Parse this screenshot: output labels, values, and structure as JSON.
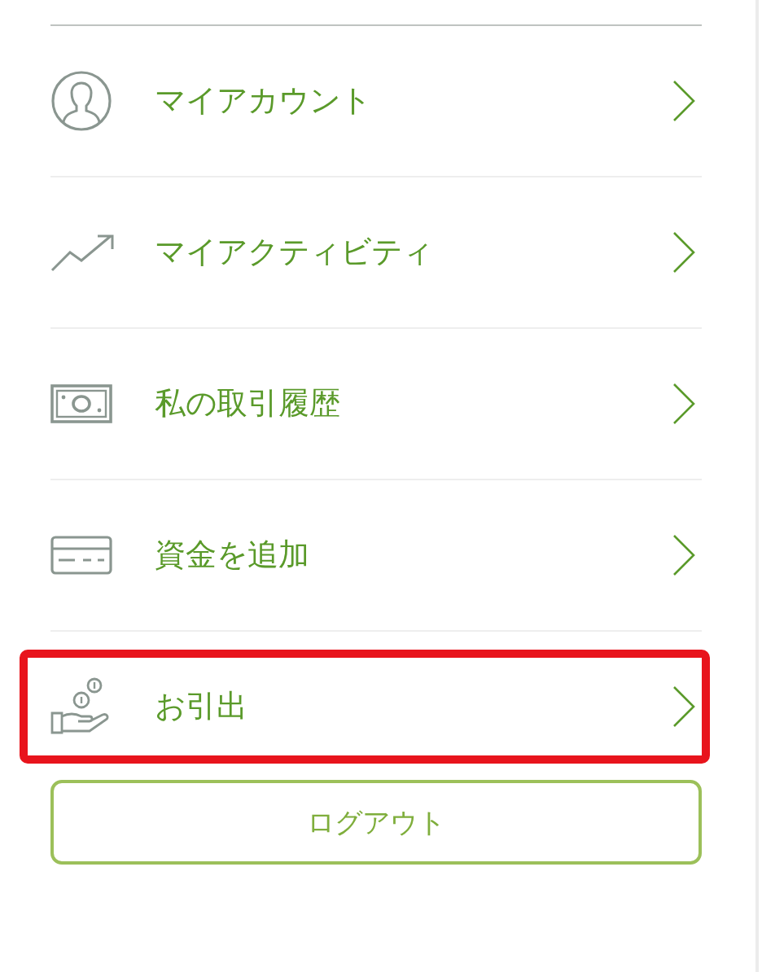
{
  "menu": [
    {
      "label": "マイアカウント",
      "highlighted": false
    },
    {
      "label": "マイアクティビティ",
      "highlighted": false
    },
    {
      "label": "私の取引履歴",
      "highlighted": false
    },
    {
      "label": "資金を追加",
      "highlighted": false
    },
    {
      "label": "お引出",
      "highlighted": true
    }
  ],
  "logout_button": "ログアウト"
}
